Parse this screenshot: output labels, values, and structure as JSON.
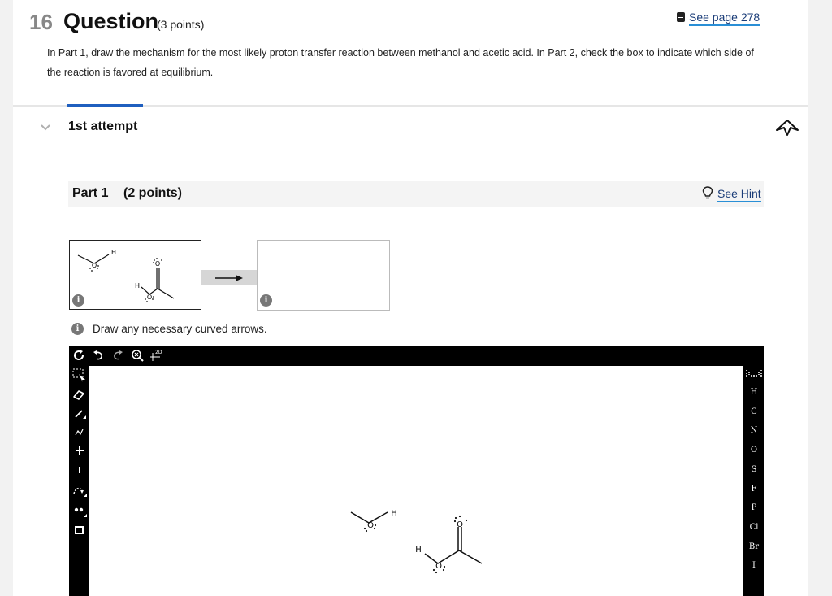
{
  "header": {
    "number": "16",
    "title": "Question",
    "points": "(3 points)",
    "see_page": "See page 278"
  },
  "instructions": "In Part 1, draw the mechanism for the most likely proton transfer reaction between methanol and acetic acid. In Part 2, check the box to indicate which side of the reaction is favored at equilibrium.",
  "attempt": {
    "label": "1st attempt"
  },
  "part": {
    "label": "Part 1",
    "points": "(2 points)",
    "hint": "See Hint"
  },
  "reaction": {
    "info_glyph": "i",
    "atoms": {
      "H": "H",
      "O": "O"
    }
  },
  "draw_instruction": "Draw any necessary curved arrows.",
  "editor": {
    "top_tools": [
      "refresh-icon",
      "undo-icon",
      "redo-icon",
      "zoom-reset-icon",
      "2d-template-icon"
    ],
    "template_label": "2D",
    "left_tools": [
      "select-icon",
      "eraser-icon",
      "bond-icon",
      "chain-icon",
      "plus-charge-icon",
      "minus-charge-icon",
      "curved-arrow-icon",
      "lone-pair-icon",
      "bracket-icon"
    ],
    "elements": [
      "H",
      "C",
      "N",
      "O",
      "S",
      "F",
      "P",
      "Cl",
      "Br",
      "I"
    ]
  }
}
